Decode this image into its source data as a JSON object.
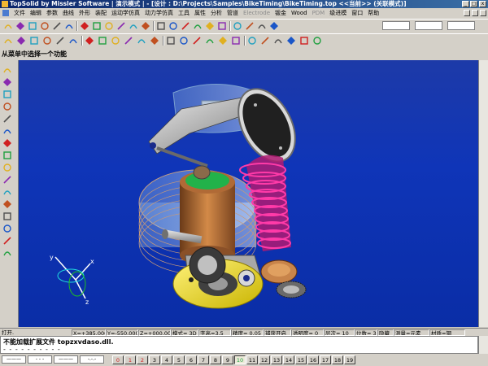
{
  "window": {
    "title": "TopSolid by Missler Software | 演示模式 | - [设计 : D:\\Projects\\Samples\\BikeTiming\\BikeTiming.top <<当前>> (关联模式)]",
    "controls": [
      "minimize",
      "maximize",
      "close"
    ]
  },
  "menu": {
    "items": [
      {
        "label": "文件",
        "enabled": true
      },
      {
        "label": "编辑",
        "enabled": true
      },
      {
        "label": "参数",
        "enabled": true
      },
      {
        "label": "曲线",
        "enabled": true
      },
      {
        "label": "外形",
        "enabled": true
      },
      {
        "label": "装配",
        "enabled": true
      },
      {
        "label": "运动学仿真",
        "enabled": true
      },
      {
        "label": "动力学仿真",
        "enabled": true
      },
      {
        "label": "工具",
        "enabled": true
      },
      {
        "label": "属性",
        "enabled": true
      },
      {
        "label": "分析",
        "enabled": true
      },
      {
        "label": "管道",
        "enabled": true
      },
      {
        "label": "Electrode",
        "enabled": false
      },
      {
        "label": "钣金",
        "enabled": true
      },
      {
        "label": "Wood",
        "enabled": true
      },
      {
        "label": "PDM",
        "enabled": false
      },
      {
        "label": "级进模",
        "enabled": true
      },
      {
        "label": "窗口",
        "enabled": true
      },
      {
        "label": "帮助",
        "enabled": true
      }
    ]
  },
  "toolbars": {
    "standard_icons": [
      "new-icon",
      "open-icon",
      "save-icon",
      "print-icon",
      "undo-icon",
      "redo-icon",
      "delete-icon",
      "cut-icon",
      "copy-icon",
      "paste-icon",
      "zoom-icon",
      "window-icon",
      "measure-icon",
      "pan-icon",
      "rotate-icon",
      "view-icon",
      "axis-icon",
      "layer-icon",
      "color-icon",
      "line-style-icon",
      "pen-icon",
      "grid-icon"
    ],
    "draw_icons": [
      "line-icon",
      "arc-icon",
      "circle-icon",
      "rectangle-icon",
      "polyline-icon",
      "spline-icon",
      "ellipse-icon",
      "point-icon",
      "frame-icon",
      "sketch-icon",
      "extrude-icon",
      "revolve-icon",
      "sweep-icon",
      "fillet-icon",
      "chamfer-icon",
      "shell-icon",
      "boolean-icon",
      "pattern-icon",
      "mirror-icon",
      "hole-icon",
      "cut-icon",
      "dimension-icon",
      "constraint-icon",
      "inquire-icon"
    ]
  },
  "prompt": "从菜单中选择一个功能",
  "left_toolbar": {
    "icons": [
      "pencil-icon",
      "curve-icon",
      "solid-icon",
      "surface-icon",
      "shape-icon",
      "assembly-icon",
      "analysis-icon",
      "sheet-icon",
      "chain-icon",
      "drafting-icon",
      "material-icon",
      "component-icon",
      "mold-icon",
      "library-icon",
      "wood-icon",
      "electrode-icon"
    ]
  },
  "viewport": {
    "scene": "bike-timing-engine-assembly",
    "axis_labels": {
      "x": "x",
      "y": "y",
      "z": "z"
    }
  },
  "status": {
    "mode": "打开.",
    "x": "X=+385.000",
    "y": "Y=-550.000",
    "z": "Z=+000.000",
    "view_mode": "模式= 3D",
    "font_height": "字高=3.5",
    "precision": "精度= 0.05",
    "snap": "捕获开启",
    "transparency": "透明度= 0",
    "layer": "层次= 10",
    "position": "位数= 3",
    "hidden": "隐藏",
    "measure": "测量=元素",
    "material": "材质=钢"
  },
  "messages": {
    "line1": "不能加载扩展文件 topzxvdaso.dll.",
    "line2": "- - - - - - - - - -"
  },
  "bottom": {
    "line_styles": [
      "———",
      "- - -",
      "———",
      "-.-.-"
    ],
    "layers": [
      "0",
      "1",
      "2",
      "3",
      "4",
      "5",
      "6",
      "7",
      "8",
      "9",
      "10",
      "11",
      "12",
      "13",
      "14",
      "15",
      "16",
      "17",
      "18",
      "19"
    ],
    "active_layer": "10"
  },
  "colors": {
    "viewport_bg": "#0f35b8",
    "title_bar": "#0a246a",
    "spring": "#d01a8a",
    "piston": "#22b24a",
    "cylinder": "#c87a3a",
    "crank": "#e8e020"
  }
}
